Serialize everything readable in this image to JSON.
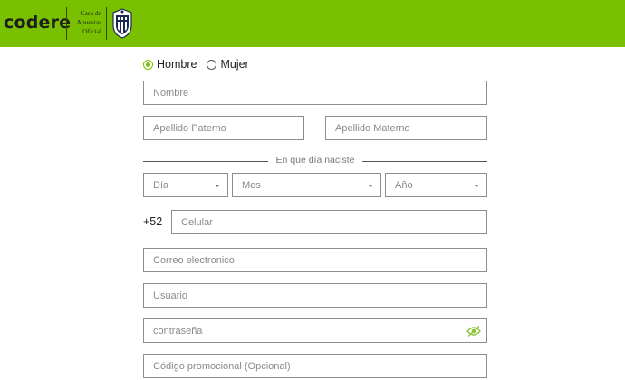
{
  "header": {
    "logo_text": "codere",
    "tagline": [
      "Casa de",
      "Apuestas",
      "Oficial"
    ],
    "crest_icon": "monterrey-crest-icon",
    "background_color": "#79c000"
  },
  "gender": {
    "options": [
      {
        "label": "Hombre",
        "selected": true
      },
      {
        "label": "Mujer",
        "selected": false
      }
    ]
  },
  "form": {
    "nombre_placeholder": "Nombre",
    "apellido_paterno_placeholder": "Apellido Paterno",
    "apellido_materno_placeholder": "Apellido Materno",
    "birth_divider": "En que día naciste",
    "dia_label": "Día",
    "mes_label": "Mes",
    "anio_label": "Año",
    "phone_prefix": "+52",
    "celular_placeholder": "Celular",
    "correo_placeholder": "Correo electronico",
    "usuario_placeholder": "Usuario",
    "password_placeholder": "contraseña",
    "password_toggle_icon": "eye-slash-icon",
    "promo_placeholder": "Código promocional (Opcional)"
  }
}
